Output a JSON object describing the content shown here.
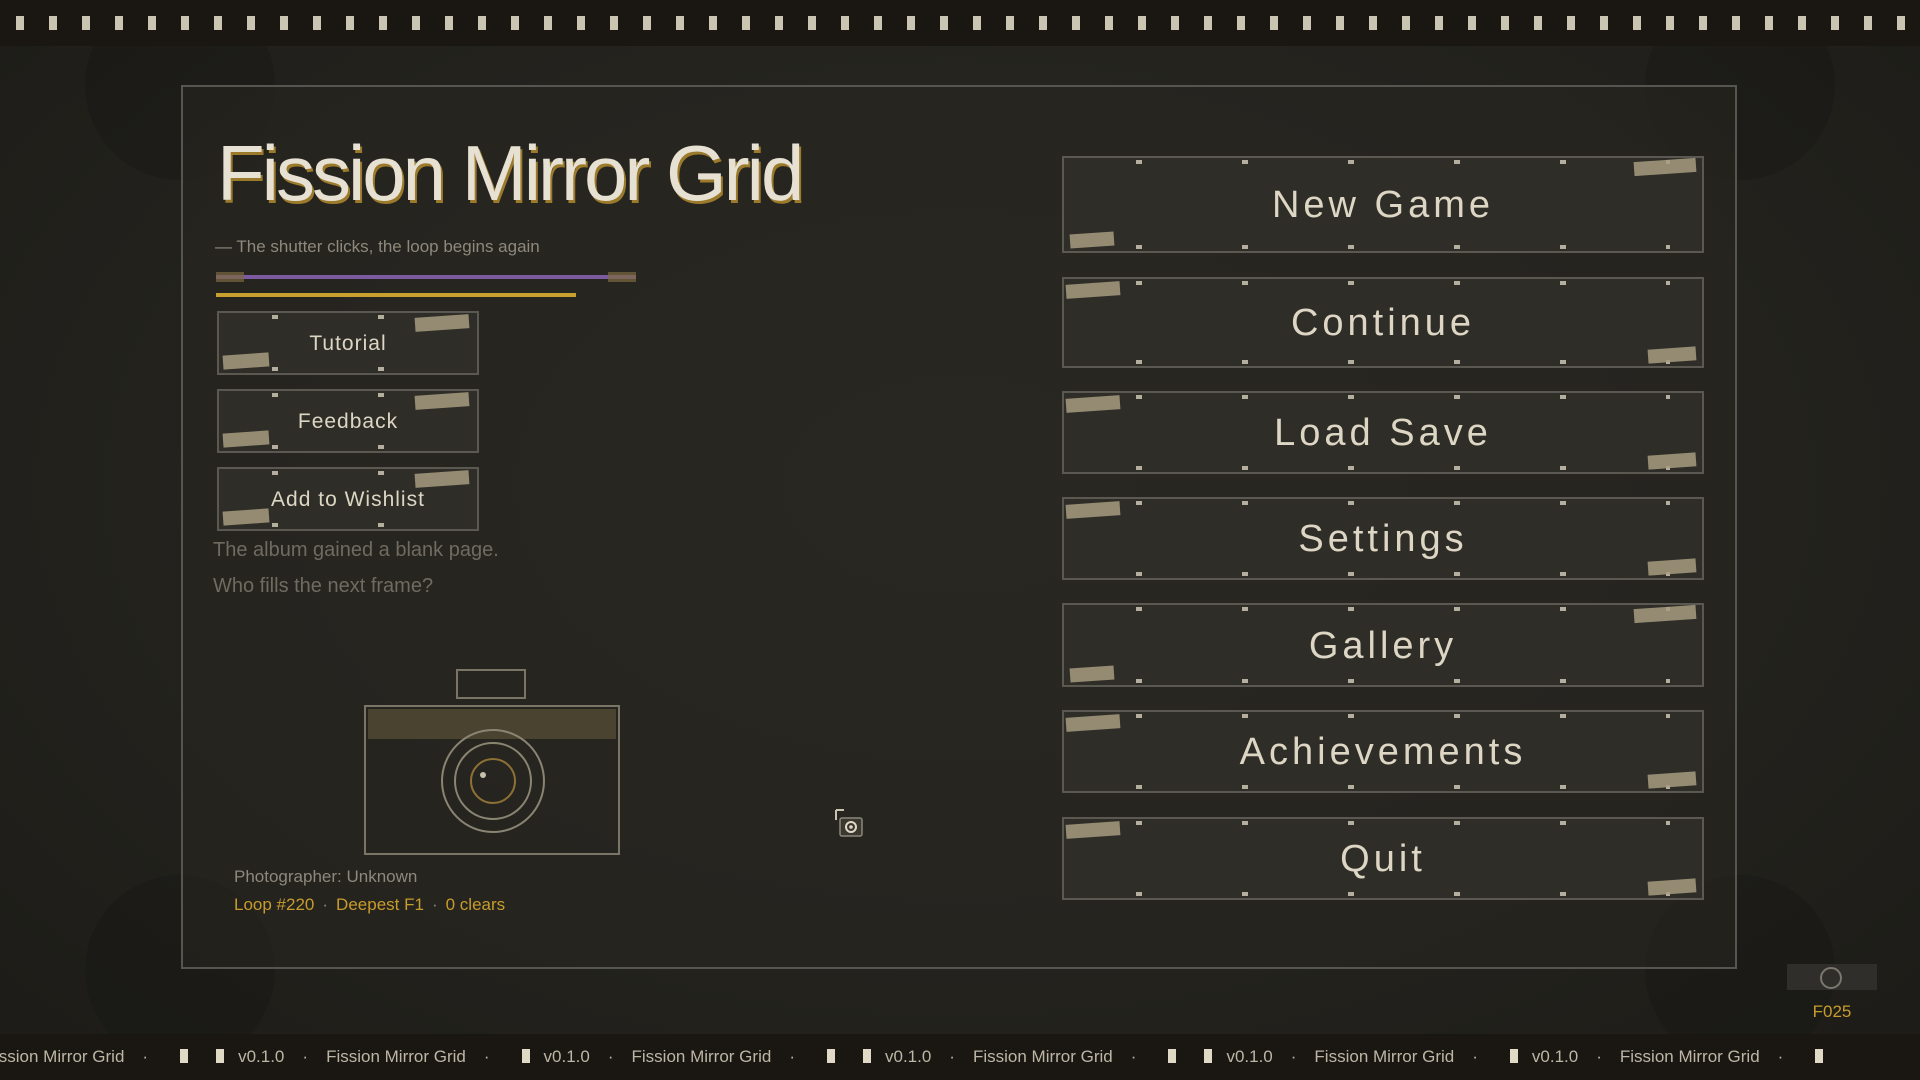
{
  "game": {
    "title": "Fission Mirror Grid",
    "tagline": "— The shutter clicks, the loop begins again"
  },
  "side_buttons": [
    {
      "label": "Tutorial"
    },
    {
      "label": "Feedback"
    },
    {
      "label": "Add to Wishlist"
    }
  ],
  "main_menu": [
    {
      "label": "New Game"
    },
    {
      "label": "Continue"
    },
    {
      "label": "Load Save"
    },
    {
      "label": "Settings"
    },
    {
      "label": "Gallery"
    },
    {
      "label": "Achievements"
    },
    {
      "label": "Quit"
    }
  ],
  "flavor": {
    "line1": "The album gained a blank page.",
    "line2": "Who fills the next frame?"
  },
  "profile": {
    "photographer": "Photographer: Unknown",
    "loop": "Loop #220",
    "deepest": "Deepest F1",
    "clears": "0 clears",
    "separator": "·"
  },
  "corner": {
    "frame_code": "F025"
  },
  "ticker": {
    "first": "ission Mirror Grid",
    "version": "v0.1.0",
    "name": "Fission Mirror Grid",
    "dot": "·"
  },
  "icons": {
    "camera": "camera-icon",
    "cursor": "camera-cursor-icon",
    "corner": "shutter-ring-icon"
  },
  "colors": {
    "background": "#25241f",
    "accent_gold": "#c89c2c",
    "accent_purple": "#7c5aa0",
    "button_bg": "#2f2d27",
    "button_border": "#5a5850",
    "text": "#ddd6c4"
  }
}
